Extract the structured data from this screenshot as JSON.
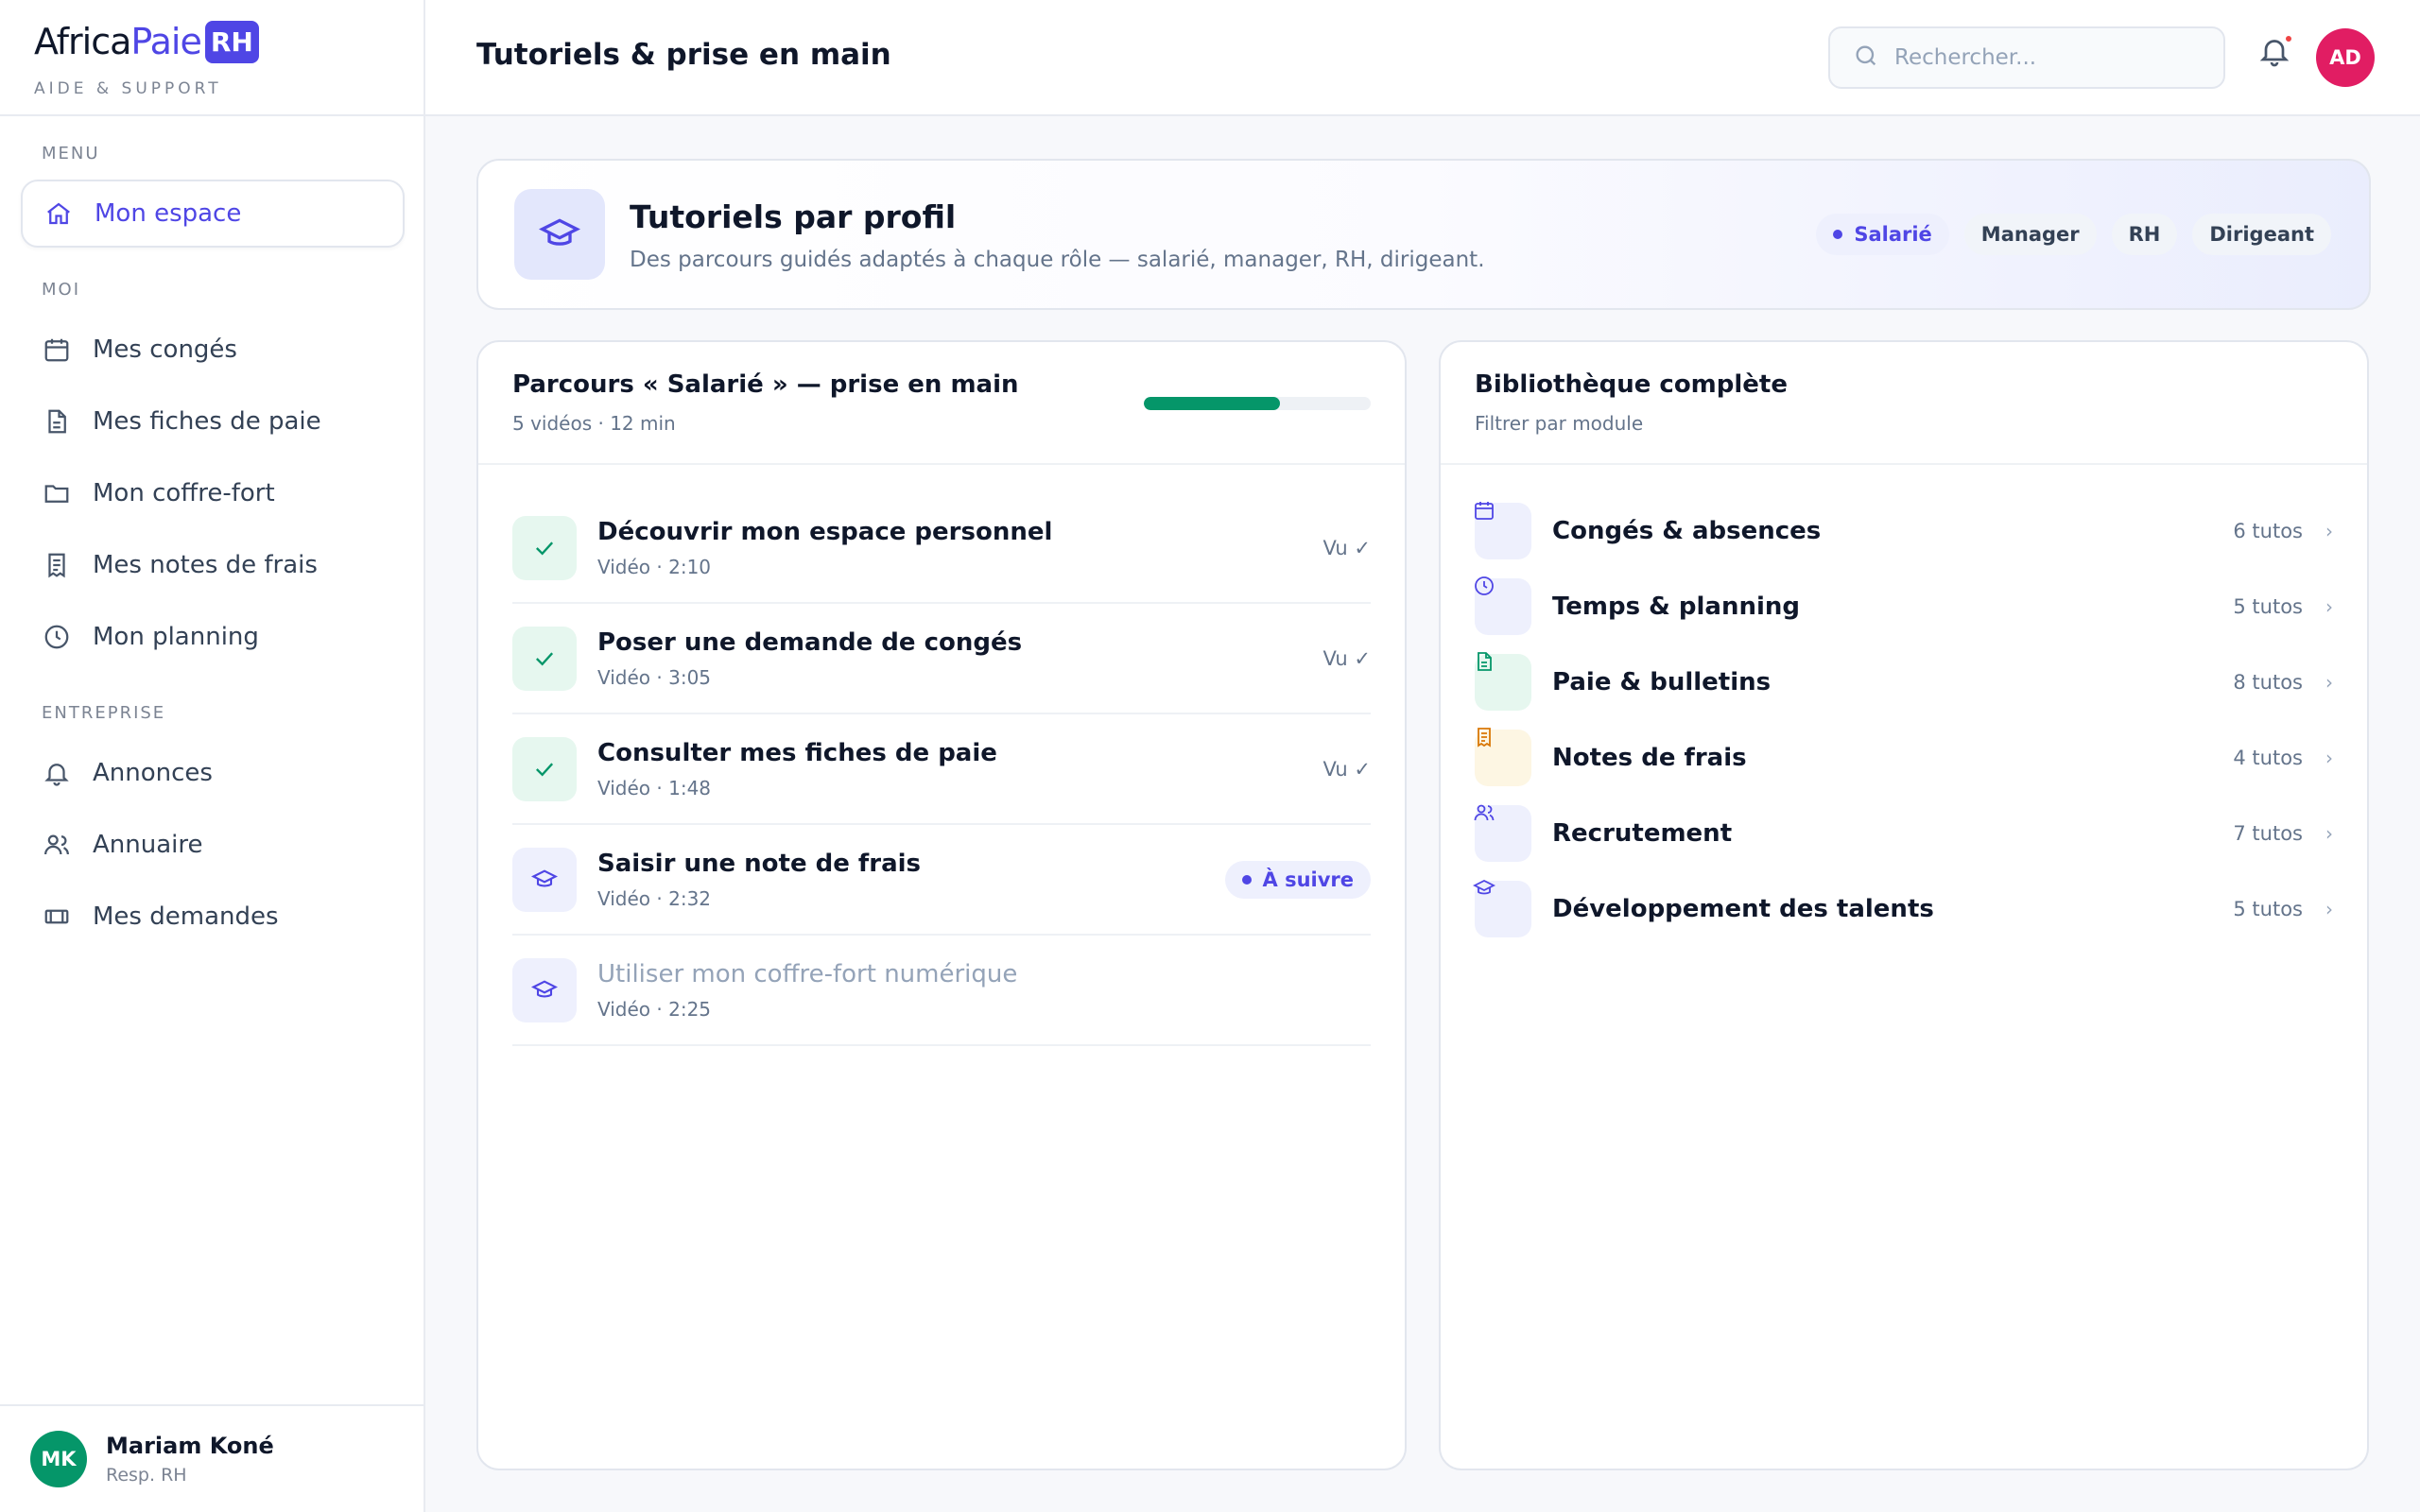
{
  "brand": {
    "name_part1": "Africa",
    "name_part2": "Paie",
    "name_badge": "RH",
    "subtitle": "AIDE & SUPPORT"
  },
  "sidebar": {
    "sections": {
      "menu": "MENU",
      "moi": "MOI",
      "entreprise": "ENTREPRISE"
    },
    "items": [
      {
        "label": "Mon espace",
        "icon": "home-icon",
        "active": true
      },
      {
        "label": "Mes congés",
        "icon": "calendar-icon"
      },
      {
        "label": "Mes fiches de paie",
        "icon": "document-icon"
      },
      {
        "label": "Mon coffre-fort",
        "icon": "folder-icon"
      },
      {
        "label": "Mes notes de frais",
        "icon": "receipt-icon"
      },
      {
        "label": "Mon planning",
        "icon": "clock-icon"
      },
      {
        "label": "Annonces",
        "icon": "bell-icon"
      },
      {
        "label": "Annuaire",
        "icon": "users-icon"
      },
      {
        "label": "Mes demandes",
        "icon": "ticket-icon"
      }
    ],
    "user": {
      "initials": "MK",
      "name": "Mariam Koné",
      "role": "Resp. RH",
      "avatar_color": "#059669"
    }
  },
  "header": {
    "title": "Tutoriels & prise en main",
    "search_placeholder": "Rechercher...",
    "avatar_initials": "AD",
    "avatar_color": "#e11d63",
    "has_notification": true
  },
  "hero": {
    "title": "Tutoriels par profil",
    "subtitle": "Des parcours guidés adaptés à chaque rôle — salarié, manager, RH, dirigeant.",
    "profiles": [
      {
        "label": "Salarié",
        "active": true
      },
      {
        "label": "Manager"
      },
      {
        "label": "RH"
      },
      {
        "label": "Dirigeant"
      }
    ]
  },
  "path": {
    "title": "Parcours « Salarié » — prise en main",
    "meta": "5 vidéos · 12 min",
    "progress": 0.6,
    "progress_color": "#059669",
    "videos": [
      {
        "title": "Découvrir mon espace personnel",
        "meta": "Vidéo · 2:10",
        "state": "done",
        "status": "Vu ✓"
      },
      {
        "title": "Poser une demande de congés",
        "meta": "Vidéo · 3:05",
        "state": "done",
        "status": "Vu ✓"
      },
      {
        "title": "Consulter mes fiches de paie",
        "meta": "Vidéo · 1:48",
        "state": "done",
        "status": "Vu ✓"
      },
      {
        "title": "Saisir une note de frais",
        "meta": "Vidéo · 2:32",
        "state": "next",
        "status": "À suivre"
      },
      {
        "title": "Utiliser mon coffre-fort numérique",
        "meta": "Vidéo · 2:25",
        "state": "locked",
        "status": ""
      }
    ]
  },
  "library": {
    "title": "Bibliothèque complète",
    "subtitle": "Filtrer par module",
    "modules": [
      {
        "title": "Congés & absences",
        "count": "6 tutos",
        "icon": "calendar-icon",
        "color": "#4f46e5",
        "bg": "#eef0fd"
      },
      {
        "title": "Temps & planning",
        "count": "5 tutos",
        "icon": "clock-icon",
        "color": "#4f46e5",
        "bg": "#eef0fd"
      },
      {
        "title": "Paie & bulletins",
        "count": "8 tutos",
        "icon": "document-icon",
        "color": "#059669",
        "bg": "#e6f7ef"
      },
      {
        "title": "Notes de frais",
        "count": "4 tutos",
        "icon": "receipt-icon",
        "color": "#d97706",
        "bg": "#fdf6e3"
      },
      {
        "title": "Recrutement",
        "count": "7 tutos",
        "icon": "users-icon",
        "color": "#4f46e5",
        "bg": "#eef0fd"
      },
      {
        "title": "Développement des talents",
        "count": "5 tutos",
        "icon": "graduation-cap-icon",
        "color": "#4f46e5",
        "bg": "#eef0fd"
      }
    ]
  }
}
